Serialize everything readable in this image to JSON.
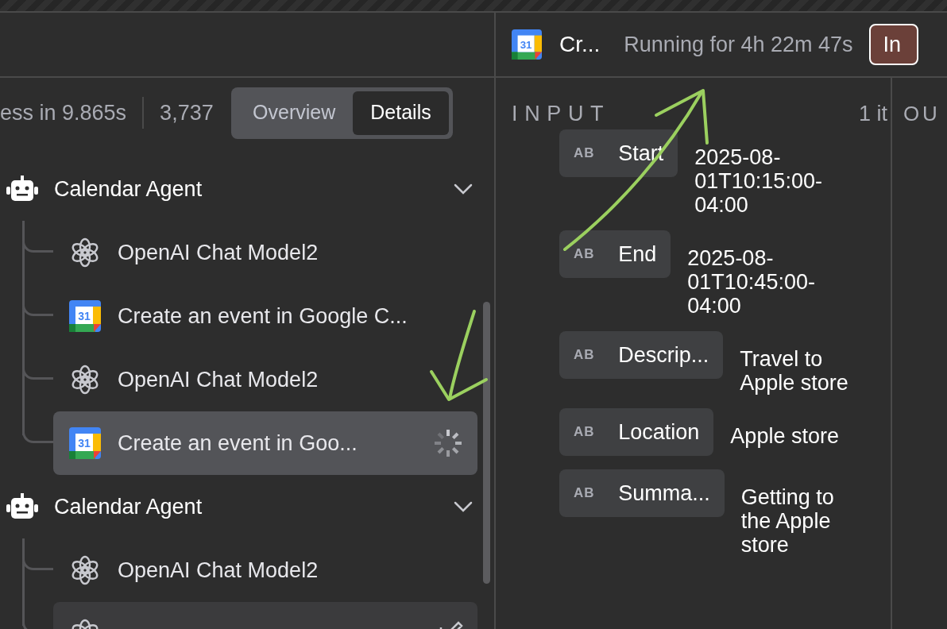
{
  "stats": {
    "duration_text": "ess in 9.865s",
    "tokens_text": "3,737"
  },
  "view_toggle": [
    {
      "label": "Overview",
      "selected": false
    },
    {
      "label": "Details",
      "selected": true
    }
  ],
  "tree": [
    {
      "label": "Calendar Agent",
      "expanded": true,
      "children": [
        {
          "kind": "openai",
          "label": "OpenAI Chat Model2",
          "selected": false,
          "hovered": false,
          "running": false,
          "edit_icon": false
        },
        {
          "kind": "calendar",
          "icon_label": "31",
          "label": "Create an event in Google C...",
          "selected": false,
          "hovered": false,
          "running": false,
          "edit_icon": false
        },
        {
          "kind": "openai",
          "label": "OpenAI Chat Model2",
          "selected": false,
          "hovered": false,
          "running": false,
          "edit_icon": false
        },
        {
          "kind": "calendar",
          "icon_label": "31",
          "label": "Create an event in Goo...",
          "selected": true,
          "hovered": false,
          "running": true,
          "edit_icon": false
        }
      ]
    },
    {
      "label": "Calendar Agent",
      "expanded": true,
      "children": [
        {
          "kind": "openai",
          "label": "OpenAI Chat Model2",
          "selected": false,
          "hovered": false,
          "running": false,
          "edit_icon": false
        },
        {
          "kind": "openai",
          "selected": false,
          "hovered": true,
          "running": false,
          "edit_icon": true
        }
      ]
    }
  ],
  "node_header": {
    "icon_label": "31",
    "title": "Cr...",
    "status_text": "Running for 4h 22m 47s",
    "button": "In"
  },
  "input": {
    "title": "INPUT",
    "count_text": "1 it",
    "fields": [
      {
        "type_label": "AB",
        "name": "Start",
        "value": "2025-08-01T10:15:00-04:00"
      },
      {
        "type_label": "AB",
        "name": "End",
        "value": "2025-08-01T10:45:00-04:00"
      },
      {
        "type_label": "AB",
        "name": "Descrip...",
        "value": "Travel to Apple store"
      },
      {
        "type_label": "AB",
        "name": "Location",
        "value": "Apple store"
      },
      {
        "type_label": "AB",
        "name": "Summa...",
        "value": "Getting to the Apple store"
      }
    ]
  },
  "output": {
    "title": "OU"
  }
}
